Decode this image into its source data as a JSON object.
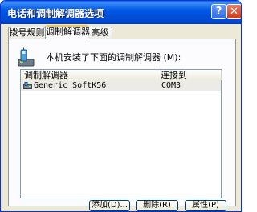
{
  "window": {
    "title": "电话和调制解调器选项",
    "help_glyph": "?",
    "close_glyph": "✕"
  },
  "tabs": [
    {
      "label": "拨号规则",
      "active": false
    },
    {
      "label": "调制解调器",
      "active": true
    },
    {
      "label": "高级",
      "active": false
    }
  ],
  "intro_text": "本机安装了下面的调制解调器 (M):",
  "modem_list": {
    "columns": [
      "调制解调器",
      "连接到"
    ],
    "rows": [
      {
        "name": "Generic SoftK56",
        "port": "COM3",
        "icon": "modem-icon"
      }
    ]
  },
  "buttons": {
    "add": "添加(D)...",
    "remove": "删除(R)",
    "properties": "属性(P)"
  },
  "colors": {
    "titlebar": "#0058e5",
    "active_tab_accent": "#ffc83c",
    "close_button": "#c6391d"
  }
}
